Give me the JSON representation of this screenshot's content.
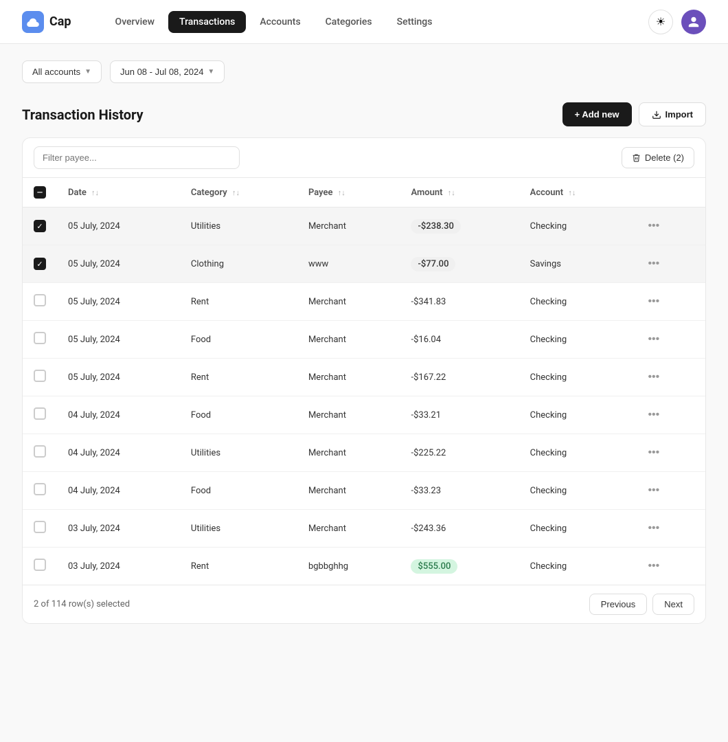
{
  "app": {
    "name": "Cap",
    "logo_icon": "☁"
  },
  "nav": {
    "items": [
      {
        "id": "overview",
        "label": "Overview",
        "active": false
      },
      {
        "id": "transactions",
        "label": "Transactions",
        "active": true
      },
      {
        "id": "accounts",
        "label": "Accounts",
        "active": false
      },
      {
        "id": "categories",
        "label": "Categories",
        "active": false
      },
      {
        "id": "settings",
        "label": "Settings",
        "active": false
      }
    ]
  },
  "filters": {
    "account_label": "All accounts",
    "date_range_label": "Jun 08 - Jul 08, 2024"
  },
  "section": {
    "title": "Transaction History",
    "add_button_label": "+ Add new",
    "import_button_label": "Import"
  },
  "toolbar": {
    "filter_placeholder": "Filter payee...",
    "delete_button_label": "Delete (2)"
  },
  "table": {
    "columns": [
      {
        "id": "date",
        "label": "Date"
      },
      {
        "id": "category",
        "label": "Category"
      },
      {
        "id": "payee",
        "label": "Payee"
      },
      {
        "id": "amount",
        "label": "Amount"
      },
      {
        "id": "account",
        "label": "Account"
      }
    ],
    "rows": [
      {
        "id": 1,
        "date": "05 July, 2024",
        "category": "Utilities",
        "payee": "Merchant",
        "amount": "-$238.30",
        "account": "Checking",
        "selected": true,
        "amount_style": "highlight-neg"
      },
      {
        "id": 2,
        "date": "05 July, 2024",
        "category": "Clothing",
        "payee": "www",
        "amount": "-$77.00",
        "account": "Savings",
        "selected": true,
        "amount_style": "highlight-neg"
      },
      {
        "id": 3,
        "date": "05 July, 2024",
        "category": "Rent",
        "payee": "Merchant",
        "amount": "-$341.83",
        "account": "Checking",
        "selected": false,
        "amount_style": "plain"
      },
      {
        "id": 4,
        "date": "05 July, 2024",
        "category": "Food",
        "payee": "Merchant",
        "amount": "-$16.04",
        "account": "Checking",
        "selected": false,
        "amount_style": "plain"
      },
      {
        "id": 5,
        "date": "05 July, 2024",
        "category": "Rent",
        "payee": "Merchant",
        "amount": "-$167.22",
        "account": "Checking",
        "selected": false,
        "amount_style": "plain"
      },
      {
        "id": 6,
        "date": "04 July, 2024",
        "category": "Food",
        "payee": "Merchant",
        "amount": "-$33.21",
        "account": "Checking",
        "selected": false,
        "amount_style": "plain"
      },
      {
        "id": 7,
        "date": "04 July, 2024",
        "category": "Utilities",
        "payee": "Merchant",
        "amount": "-$225.22",
        "account": "Checking",
        "selected": false,
        "amount_style": "plain"
      },
      {
        "id": 8,
        "date": "04 July, 2024",
        "category": "Food",
        "payee": "Merchant",
        "amount": "-$33.23",
        "account": "Checking",
        "selected": false,
        "amount_style": "plain"
      },
      {
        "id": 9,
        "date": "03 July, 2024",
        "category": "Utilities",
        "payee": "Merchant",
        "amount": "-$243.36",
        "account": "Checking",
        "selected": false,
        "amount_style": "plain"
      },
      {
        "id": 10,
        "date": "03 July, 2024",
        "category": "Rent",
        "payee": "bgbbghhg",
        "amount": "$555.00",
        "account": "Checking",
        "selected": false,
        "amount_style": "highlight-pos"
      }
    ]
  },
  "footer": {
    "rows_selected_text": "2 of 114 row(s) selected",
    "prev_label": "Previous",
    "next_label": "Next"
  }
}
